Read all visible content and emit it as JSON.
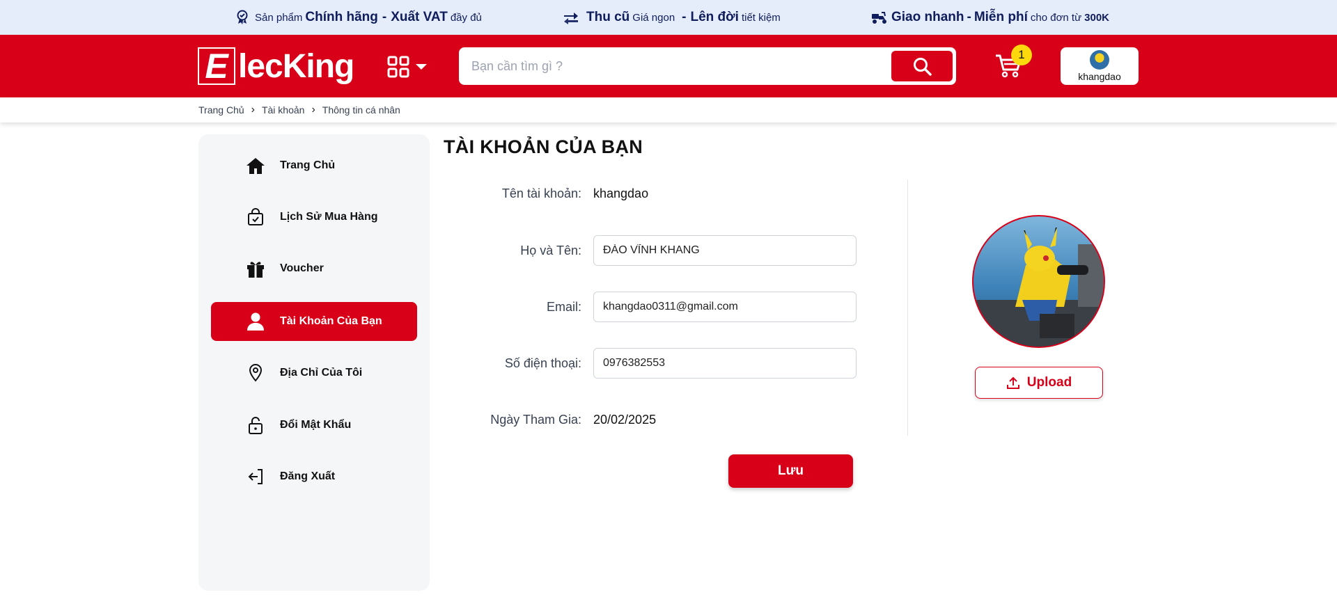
{
  "promo": {
    "item1": {
      "pre": "Sản phẩm",
      "bold1": "Chính hãng",
      "dash": "-",
      "bold2": "Xuất VAT",
      "post": "đầy đủ"
    },
    "item2": {
      "bold1": "Thu cũ",
      "mid": "Giá ngon",
      "dash": "-",
      "bold2": "Lên đời",
      "post": "tiết kiệm"
    },
    "item3": {
      "bold1": "Giao nhanh",
      "dash": "-",
      "bold2": "Miễn phí",
      "post": "cho đơn từ",
      "amount": "300K"
    }
  },
  "header": {
    "logo_letter": "E",
    "logo_rest": "lecKing",
    "search_placeholder": "Bạn cần tìm gì ?",
    "cart_count": "1",
    "username": "khangdao"
  },
  "breadcrumb": [
    "Trang Chủ",
    "Tài khoản",
    "Thông tin cá nhân"
  ],
  "sidebar": {
    "items": [
      {
        "label": "Trang Chủ",
        "icon": "home-icon"
      },
      {
        "label": "Lịch Sử Mua Hàng",
        "icon": "shopping-bag-check-icon"
      },
      {
        "label": "Voucher",
        "icon": "gift-icon"
      },
      {
        "label": "Tài Khoản Của Bạn",
        "icon": "user-icon",
        "active": true
      },
      {
        "label": "Địa Chỉ Của Tôi",
        "icon": "map-pin-icon"
      },
      {
        "label": "Đổi Mật Khẩu",
        "icon": "lock-icon"
      },
      {
        "label": "Đăng Xuất",
        "icon": "logout-icon"
      }
    ]
  },
  "account": {
    "title": "TÀI KHOẢN CỦA BẠN",
    "username_label": "Tên tài khoản:",
    "username_value": "khangdao",
    "fullname_label": "Họ và Tên:",
    "fullname_value": "ĐÀO VĨNH KHANG",
    "email_label": "Email:",
    "email_value": "khangdao0311@gmail.com",
    "phone_label": "Số điện thoại:",
    "phone_value": "0976382553",
    "joined_label": "Ngày Tham Gia:",
    "joined_value": "20/02/2025",
    "save_label": "Lưu",
    "upload_label": "Upload"
  },
  "colors": {
    "brand_red": "#d70018",
    "promo_bg": "#e5ecfa",
    "promo_text": "#0f1d5c",
    "badge_yellow": "#fbd90c",
    "sidebar_bg": "#f5f6f8"
  }
}
